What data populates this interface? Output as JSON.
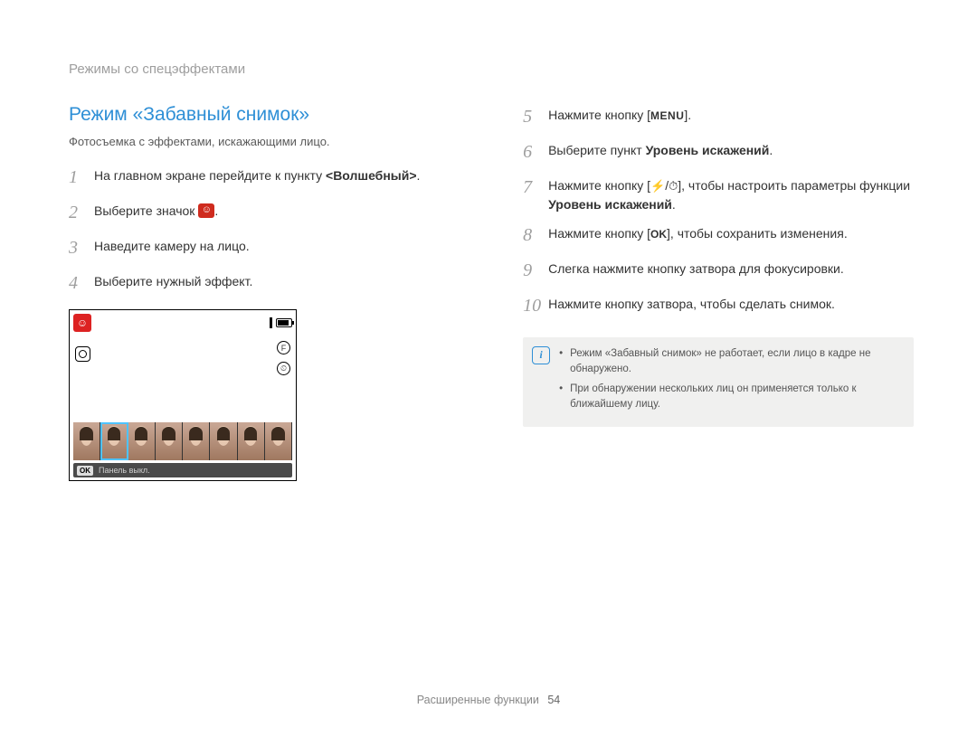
{
  "header": "Режимы со спецэффектами",
  "title": "Режим «Забавный снимок»",
  "subtitle": "Фотосъемка с эффектами, искажающими лицо.",
  "steps_left": [
    {
      "n": "1",
      "pre": "На главном экране перейдите к пункту ",
      "bold": "<Волшебный>",
      "post": "."
    },
    {
      "n": "2",
      "pre": "Выберите значок ",
      "icon": "face-effect",
      "post": "."
    },
    {
      "n": "3",
      "pre": "Наведите камеру на лицо."
    },
    {
      "n": "4",
      "pre": "Выберите нужный эффект."
    }
  ],
  "steps_right": [
    {
      "n": "5",
      "pre": "Нажмите кнопку [",
      "menu": "MENU",
      "post": "]."
    },
    {
      "n": "6",
      "pre": "Выберите пункт ",
      "bold": "Уровень искажений",
      "post": "."
    },
    {
      "n": "7",
      "pre": "Нажмите кнопку [",
      "flash": true,
      "slash": "/",
      "timer": true,
      "mid": "], чтобы настроить параметры функции ",
      "bold": "Уровень искажений",
      "post": "."
    },
    {
      "n": "8",
      "pre": "Нажмите кнопку [",
      "ok": "OK",
      "mid": "], чтобы сохранить изменения."
    },
    {
      "n": "9",
      "pre": "Слегка нажмите кнопку затвора для фокусировки."
    },
    {
      "n": "10",
      "pre": "Нажмите кнопку затвора, чтобы сделать снимок."
    }
  ],
  "camera": {
    "ok": "OK",
    "panel_text": "Панель выкл."
  },
  "note": {
    "items": [
      "Режим «Забавный снимок» не работает, если лицо в кадре не обнаружено.",
      "При обнаружении нескольких лиц он применяется только к ближайшему лицу."
    ]
  },
  "footer": {
    "section": "Расширенные функции",
    "page": "54"
  }
}
